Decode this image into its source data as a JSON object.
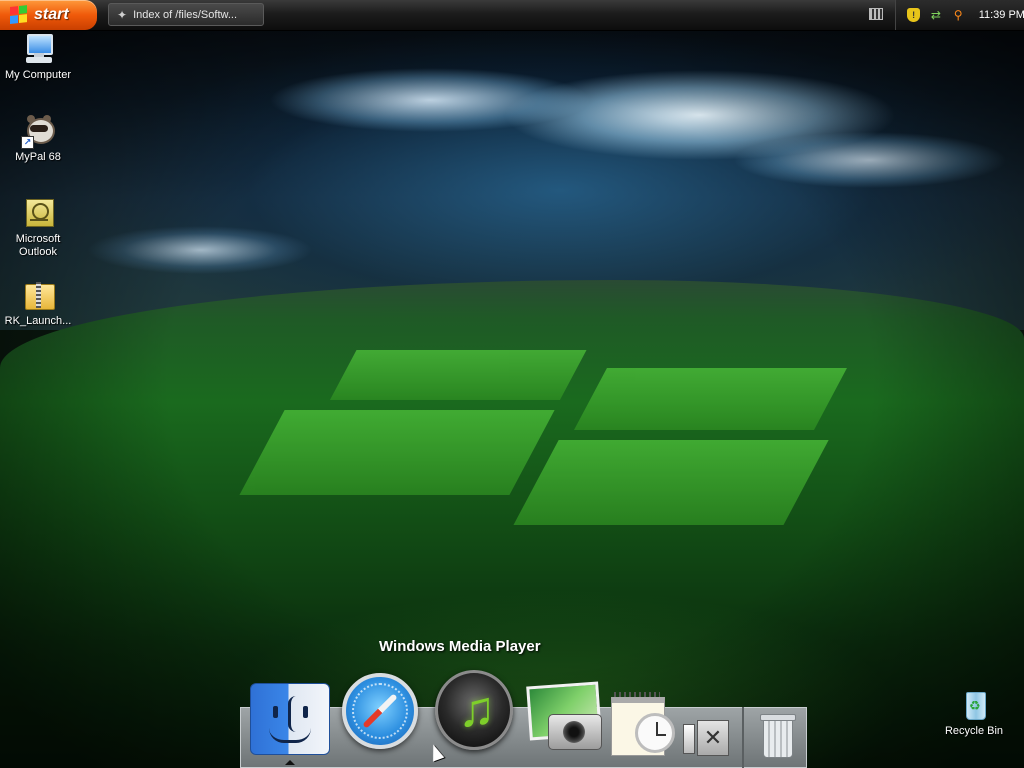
{
  "taskbar": {
    "start_label": "start",
    "task_item": "Index of /files/Softw...",
    "clock": "11:39 PM",
    "icons": {
      "start_logo": "windows-flag-icon",
      "task_icon": "browser-icon",
      "keyboard": "keyboard-icon",
      "tray": [
        "security-shield-icon",
        "network-icon",
        "search-magnifier-icon"
      ]
    }
  },
  "desktop": {
    "icons": [
      {
        "label": "My Computer",
        "icon": "computer-icon"
      },
      {
        "label": "MyPal 68",
        "icon": "mypal-browser-icon"
      },
      {
        "label": "Microsoft Outlook",
        "icon": "outlook-icon"
      },
      {
        "label": "RK_Launch...",
        "icon": "zip-folder-icon"
      },
      {
        "label": "Recycle Bin",
        "icon": "recycle-bin-icon"
      }
    ]
  },
  "dock": {
    "tooltip": "Windows Media Player",
    "items": [
      {
        "name": "finder",
        "icon": "finder-icon",
        "active": true
      },
      {
        "name": "safari",
        "icon": "safari-compass-icon"
      },
      {
        "name": "windows-media-player",
        "icon": "media-player-icon"
      },
      {
        "name": "photos",
        "icon": "camera-photo-icon"
      },
      {
        "name": "calendar-clock",
        "icon": "calendar-clock-icon"
      },
      {
        "name": "preferences",
        "icon": "system-preferences-icon"
      },
      {
        "name": "trash",
        "icon": "trash-icon"
      }
    ]
  },
  "colors": {
    "start_button": "#f05a0a",
    "taskbar": "#1c1c1c",
    "grass": "#1a6a1e",
    "sky": "#1b3140"
  }
}
